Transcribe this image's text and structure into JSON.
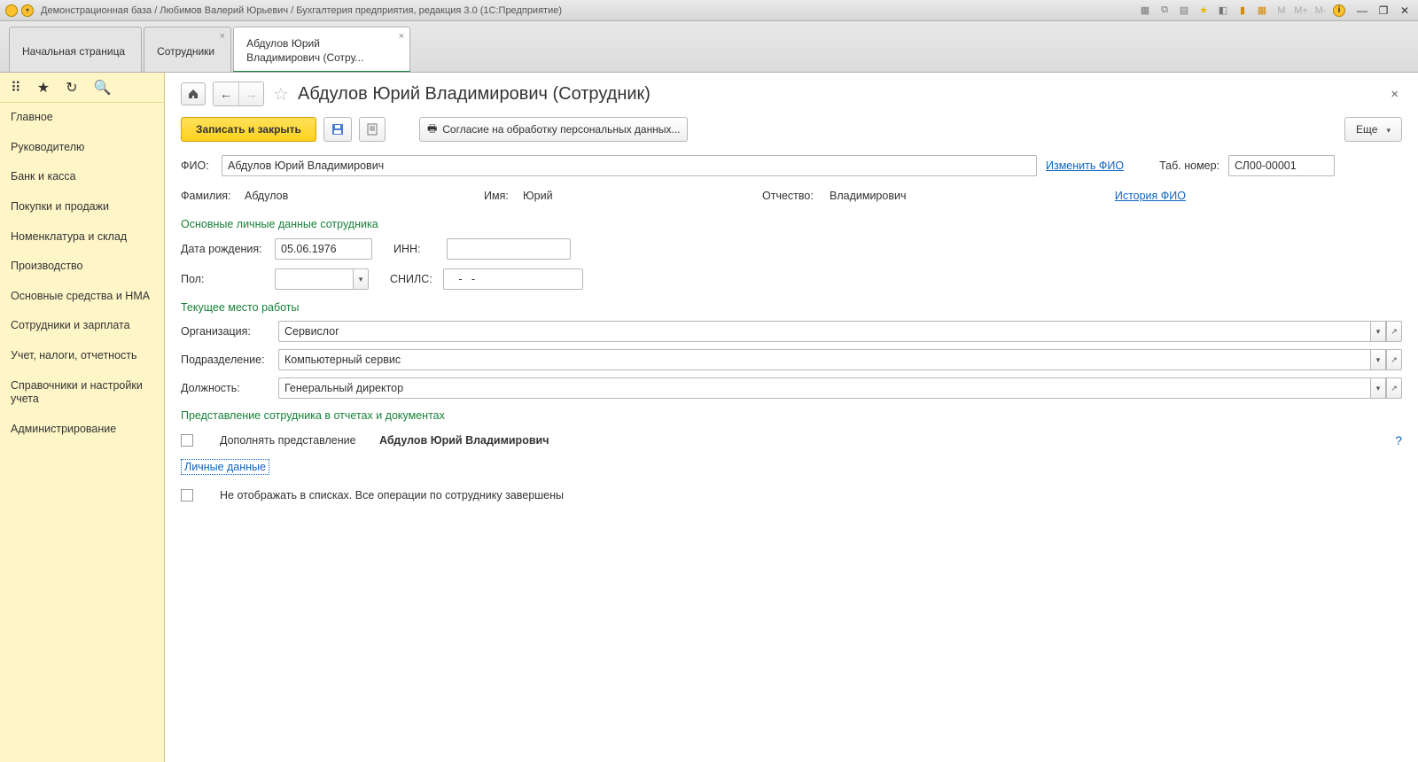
{
  "window": {
    "title": "Демонстрационная база / Любимов Валерий Юрьевич / Бухгалтерия предприятия, редакция 3.0  (1С:Предприятие)",
    "m_labels": [
      "M",
      "M+",
      "M-"
    ]
  },
  "tabs": [
    {
      "label": "Начальная страница",
      "closable": false
    },
    {
      "label": "Сотрудники",
      "closable": true
    },
    {
      "label": "Абдулов Юрий Владимирович (Сотру...",
      "closable": true,
      "active": true
    }
  ],
  "sidebar": {
    "items": [
      "Главное",
      "Руководителю",
      "Банк и касса",
      "Покупки и продажи",
      "Номенклатура и склад",
      "Производство",
      "Основные средства и НМА",
      "Сотрудники и зарплата",
      "Учет, налоги, отчетность",
      "Справочники и настройки учета",
      "Администрирование"
    ]
  },
  "page": {
    "title": "Абдулов Юрий Владимирович (Сотрудник)",
    "toolbar": {
      "save_close": "Записать и закрыть",
      "consent": "Согласие на обработку персональных данных...",
      "more": "Еще"
    },
    "fio": {
      "label": "ФИО:",
      "value": "Абдулов Юрий Владимирович",
      "change_link": "Изменить ФИО",
      "tabnum_label": "Таб. номер:",
      "tabnum_value": "СЛ00-00001",
      "surname_label": "Фамилия:",
      "surname": "Абдулов",
      "name_label": "Имя:",
      "name": "Юрий",
      "patronym_label": "Отчество:",
      "patronym": "Владимирович",
      "history_link": "История ФИО"
    },
    "personal": {
      "section": "Основные личные данные сотрудника",
      "birth_label": "Дата рождения:",
      "birth": "05.06.1976",
      "inn_label": "ИНН:",
      "inn": "",
      "gender_label": "Пол:",
      "gender": "",
      "snils_label": "СНИЛС:",
      "snils": "   -   -"
    },
    "work": {
      "section": "Текущее место работы",
      "org_label": "Организация:",
      "org": "Сервислог",
      "dept_label": "Подразделение:",
      "dept": "Компьютерный сервис",
      "pos_label": "Должность:",
      "pos": "Генеральный директор"
    },
    "repr": {
      "section": "Представление сотрудника в отчетах и документах",
      "chk_label": "Дополнять представление",
      "repr_value": "Абдулов Юрий Владимирович",
      "help": "?"
    },
    "personal_link": "Личные данные",
    "hide_label": "Не отображать в списках. Все операции по сотруднику завершены"
  }
}
